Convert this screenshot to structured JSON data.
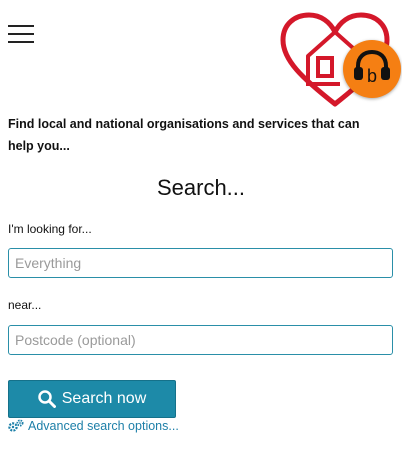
{
  "header": {
    "menu_icon": "hamburger-menu-icon",
    "logo_icon": "heart-house-logo",
    "audio_icon": "headphones-b-icon",
    "accent_red": "#d4182a",
    "accent_orange": "#f57f13"
  },
  "intro": "Find local and national organisations and services that can help you...",
  "search": {
    "heading": "Search...",
    "looking_label": "I'm looking for...",
    "looking_placeholder": "Everything",
    "near_label": "near...",
    "postcode_placeholder": "Postcode (optional)",
    "submit_label": "Search now",
    "submit_icon": "magnifier-icon",
    "advanced_icon": "gears-icon",
    "advanced_label": "Advanced search options...",
    "button_color": "#1d8aa8",
    "link_color": "#1d7fa8"
  }
}
